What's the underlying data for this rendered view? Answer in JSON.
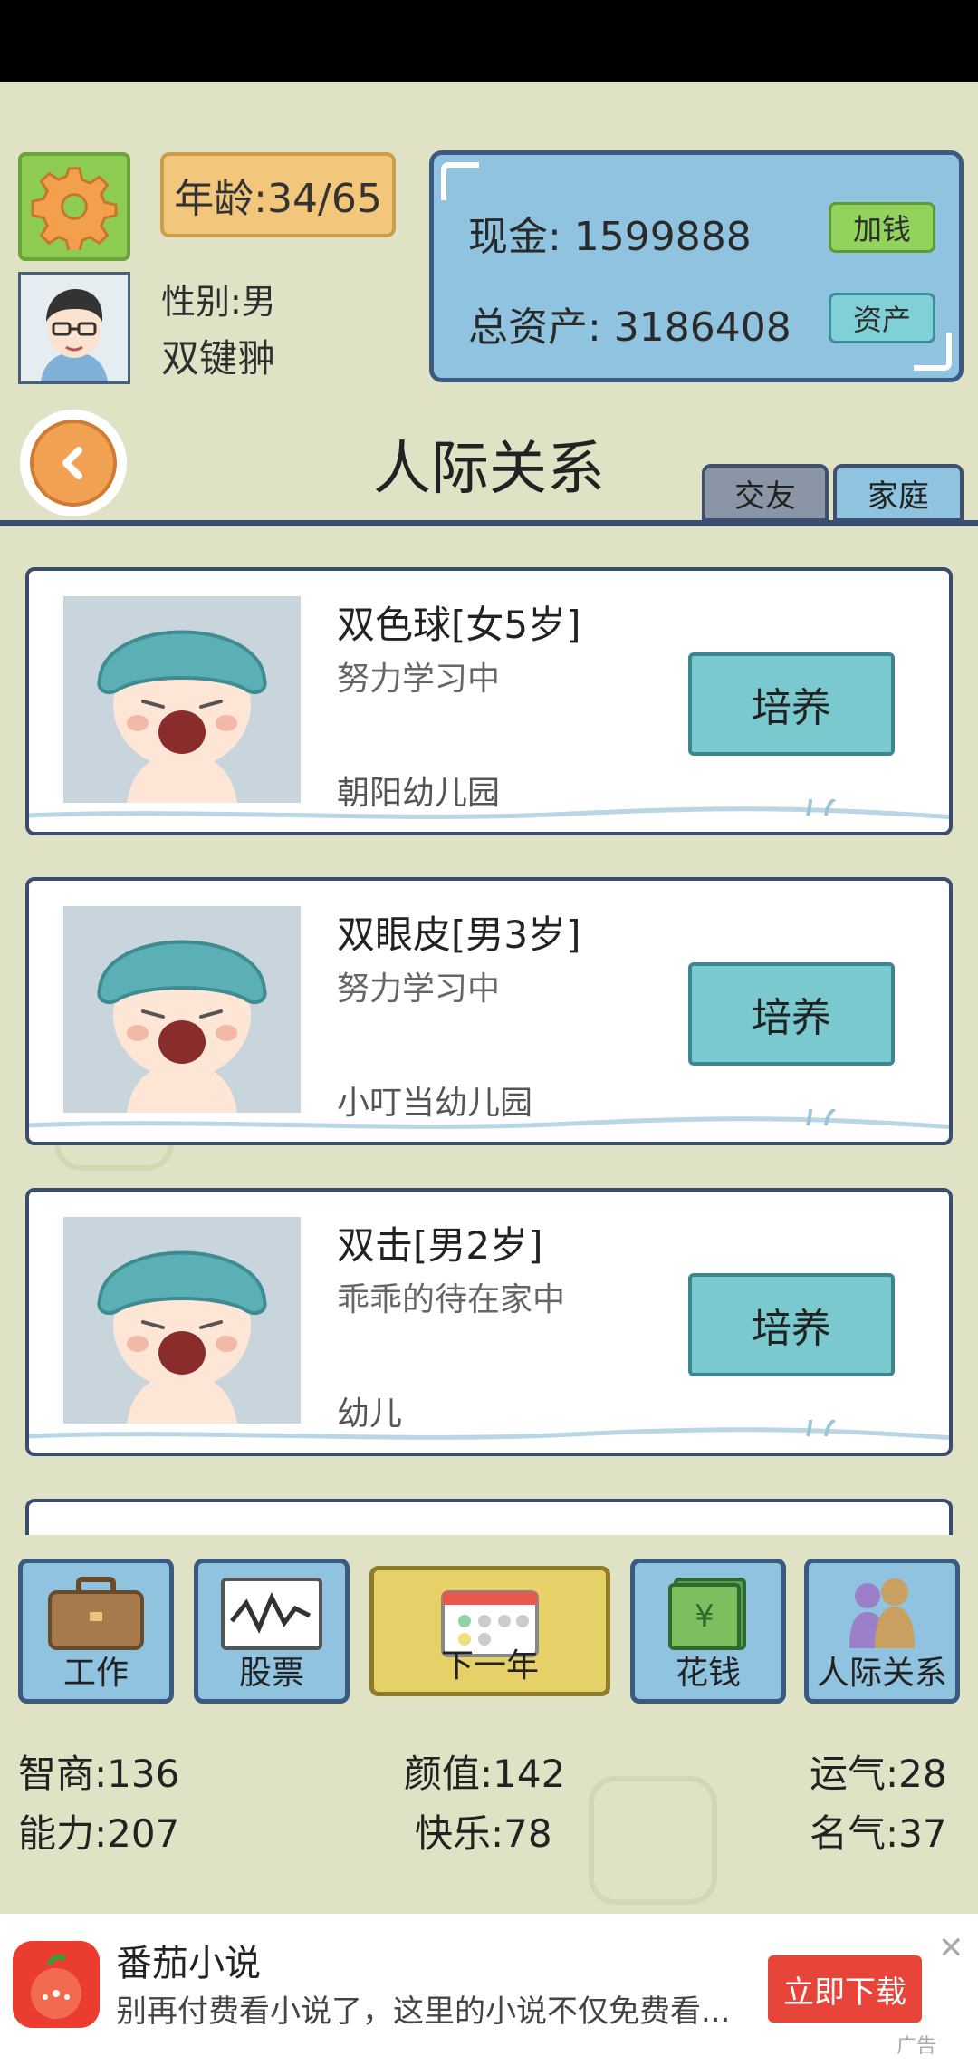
{
  "player": {
    "age_label": "年龄:34/65",
    "gender_label": "性别:男",
    "name": "双键翀"
  },
  "money": {
    "cash_label": "现金: 1599888",
    "add_money_label": "加钱",
    "total_assets_label": "总资产: 3186408",
    "assets_label": "资产"
  },
  "page": {
    "title": "人际关系",
    "tabs": [
      {
        "label": "交友"
      },
      {
        "label": "家庭"
      }
    ]
  },
  "children": [
    {
      "name": "双色球[女5岁]",
      "status": "努力学习中",
      "place": "朝阳幼儿园",
      "action": "培养"
    },
    {
      "name": "双眼皮[男3岁]",
      "status": "努力学习中",
      "place": "小叮当幼儿园",
      "action": "培养"
    },
    {
      "name": "双击[男2岁]",
      "status": "乖乖的待在家中",
      "place": "幼儿",
      "action": "培养"
    }
  ],
  "nav": [
    {
      "label": "工作",
      "icon": "briefcase-icon"
    },
    {
      "label": "股票",
      "icon": "stock-chart-icon"
    },
    {
      "label": "下一年",
      "icon": "calendar-icon"
    },
    {
      "label": "花钱",
      "icon": "money-icon"
    },
    {
      "label": "人际关系",
      "icon": "people-icon"
    }
  ],
  "stats": {
    "iq": "智商:136",
    "looks": "颜值:142",
    "luck": "运气:28",
    "ability": "能力:207",
    "happiness": "快乐:78",
    "fame": "名气:37"
  },
  "ad": {
    "title": "番茄小说",
    "desc": "别再付费看小说了，这里的小说不仅免费看...",
    "button": "立即下载",
    "tag": "广告",
    "close": "✕"
  },
  "colors": {
    "background": "#dfe2c4",
    "panel_blue": "#8fc3df",
    "button_cyan": "#79c9cf",
    "dark_border": "#3a4d6e",
    "ad_red": "#e8453a"
  }
}
